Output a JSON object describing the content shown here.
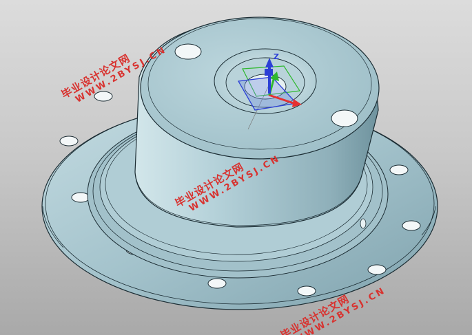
{
  "view": {
    "triad_label": "Z"
  },
  "watermarks": [
    {
      "cn": "毕业设计论文网",
      "url": "WWW.2BYSJ.CN"
    },
    {
      "cn": "毕业设计论文网",
      "url": "WWW.2BYSJ.CN"
    },
    {
      "cn": "毕业设计论文网",
      "url": "WWW.2BYSJ.CN"
    }
  ],
  "colors": {
    "part_face": "#a9c7d0",
    "part_edge": "#1b2c33",
    "triad_x": "#e53030",
    "triad_y": "#2fb82f",
    "triad_z": "#2b3fd6",
    "watermark": "#d8322f"
  }
}
